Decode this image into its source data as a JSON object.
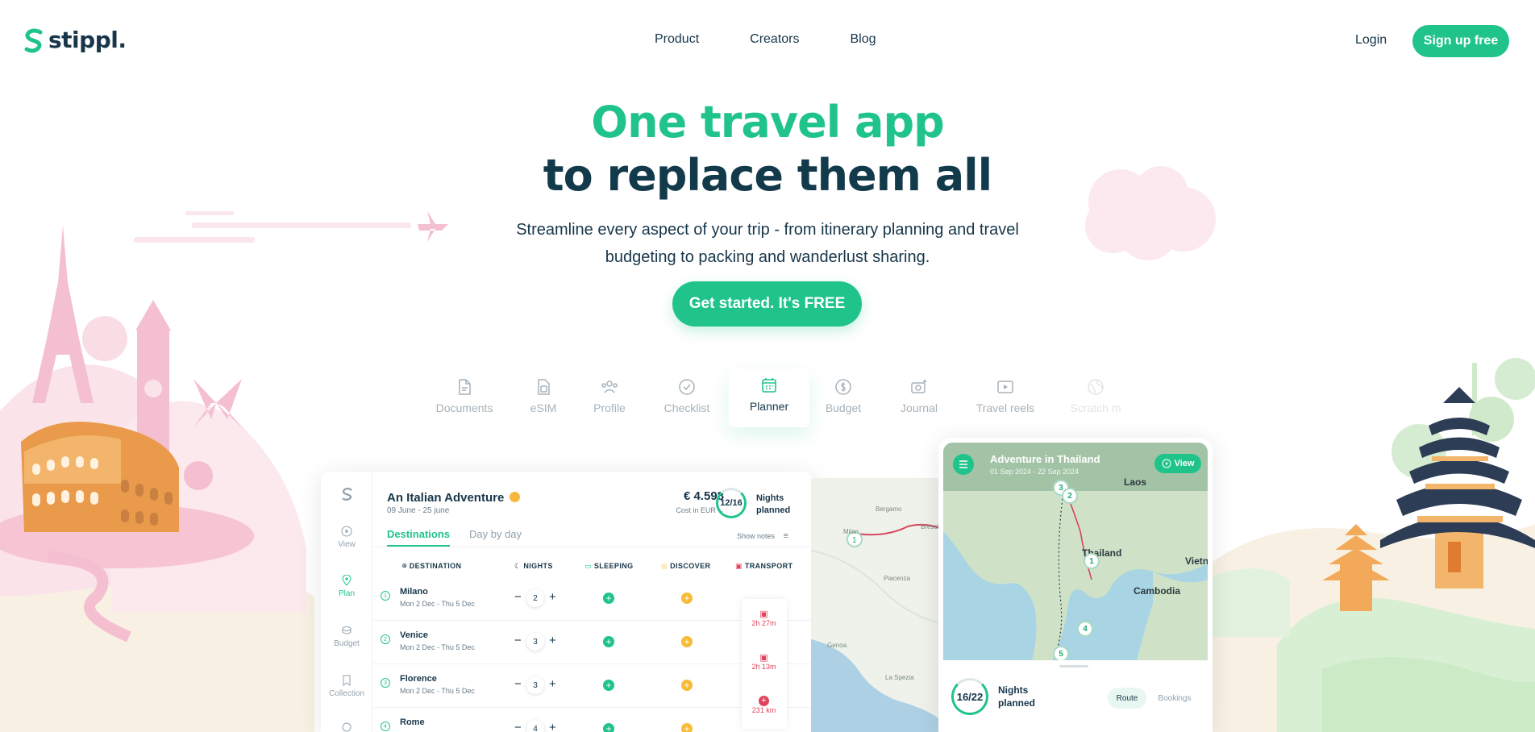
{
  "brand": {
    "name": "stippl.",
    "color": "#20c48b",
    "dark": "#17364a"
  },
  "nav": {
    "links": [
      "Product",
      "Creators",
      "Blog"
    ],
    "login": "Login",
    "signup": "Sign up free"
  },
  "hero": {
    "headline_1": "One travel app",
    "headline_2": "to replace them all",
    "subtitle": "Streamline every aspect of your trip - from itinerary planning and travel budgeting to packing and wanderlust sharing.",
    "cta": "Get started. It's FREE"
  },
  "features": {
    "tabs": [
      {
        "label": "Documents",
        "icon": "document-icon"
      },
      {
        "label": "eSIM",
        "icon": "sim-card-icon"
      },
      {
        "label": "Profile",
        "icon": "people-icon"
      },
      {
        "label": "Checklist",
        "icon": "check-circle-icon"
      },
      {
        "label": "Planner",
        "icon": "calendar-icon",
        "active": true
      },
      {
        "label": "Budget",
        "icon": "coin-icon"
      },
      {
        "label": "Journal",
        "icon": "camera-icon"
      },
      {
        "label": "Travel reels",
        "icon": "video-icon"
      },
      {
        "label": "Scratch m",
        "icon": "globe-icon"
      }
    ]
  },
  "planner": {
    "sidebar": [
      "View",
      "Plan",
      "Budget",
      "Collection"
    ],
    "trip_title": "An Italian Adventure",
    "trip_dates": "09 June - 25 june",
    "cost": "€ 4.598",
    "cost_sub": "Cost in EUR",
    "nights_ring": "12/16",
    "nights_label_1": "Nights",
    "nights_label_2": "planned",
    "tab_destinations": "Destinations",
    "tab_daybyday": "Day by day",
    "show_notes": "Show notes",
    "columns": {
      "destination": "DESTINATION",
      "nights": "NIGHTS",
      "sleeping": "SLEEPING",
      "discover": "DISCOVER",
      "transport": "TRANSPORT"
    },
    "rows": [
      {
        "num": "1",
        "city": "Milano",
        "dates": "Mon 2 Dec - Thu 5 Dec",
        "nights": "2"
      },
      {
        "num": "2",
        "city": "Venice",
        "dates": "Mon 2 Dec - Thu 5 Dec",
        "nights": "3"
      },
      {
        "num": "3",
        "city": "Florence",
        "dates": "Mon 2 Dec - Thu 5 Dec",
        "nights": "3"
      },
      {
        "num": "4",
        "city": "Rome",
        "dates": "",
        "nights": "4"
      }
    ],
    "transport": [
      "2h 27m",
      "2h 13m",
      "231 km"
    ]
  },
  "phone": {
    "title": "Adventure in Thailand",
    "dates": "01 Sep 2024 - 22 Sep 2024",
    "view": "View",
    "map_labels": [
      "Laos",
      "Thailand",
      "Cambodia",
      "Vietn"
    ],
    "pins": [
      "3",
      "2",
      "1",
      "4",
      "5"
    ],
    "nights_ring": "16/22",
    "nights_label_1": "Nights",
    "nights_label_2": "planned",
    "route": "Route",
    "bookings": "Bookings"
  },
  "mapstrip": {
    "labels": [
      "Bergamo",
      "Brescia",
      "Milan",
      "Piacenza",
      "Genoa",
      "La Spezia"
    ]
  }
}
